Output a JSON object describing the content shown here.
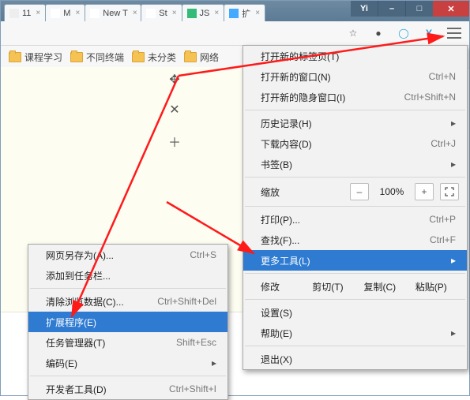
{
  "tabs": [
    "11",
    "M",
    "New T",
    "St",
    "JS",
    "扩"
  ],
  "win": {
    "yi": "Yi",
    "min": "–",
    "max": "□",
    "close": "✕"
  },
  "toolbar": {
    "star": "☆",
    "evernote": "●",
    "circle": "◯",
    "y": "Y"
  },
  "bookmarks": [
    "课程学习",
    "不同终端",
    "未分类",
    "网络"
  ],
  "tools": {
    "move": "✥",
    "close": "✕",
    "add": "＋"
  },
  "main": {
    "newtab": {
      "l": "打开新的标签页(T)",
      "s": ""
    },
    "newwin": {
      "l": "打开新的窗口(N)",
      "s": "Ctrl+N"
    },
    "incog": {
      "l": "打开新的隐身窗口(I)",
      "s": "Ctrl+Shift+N"
    },
    "history": {
      "l": "历史记录(H)",
      "s": ""
    },
    "downloads": {
      "l": "下载内容(D)",
      "s": "Ctrl+J"
    },
    "bookmarks": {
      "l": "书签(B)",
      "s": ""
    },
    "zoom": {
      "l": "缩放",
      "minus": "–",
      "val": "100%",
      "plus": "+"
    },
    "print": {
      "l": "打印(P)...",
      "s": "Ctrl+P"
    },
    "find": {
      "l": "查找(F)...",
      "s": "Ctrl+F"
    },
    "moretools": {
      "l": "更多工具(L)"
    },
    "edit": {
      "a": "修改",
      "cut": "剪切(T)",
      "copy": "复制(C)",
      "paste": "粘贴(P)"
    },
    "settings": {
      "l": "设置(S)"
    },
    "help": {
      "l": "帮助(E)"
    },
    "exit": {
      "l": "退出(X)"
    }
  },
  "sub": {
    "saveas": {
      "l": "网页另存为(A)...",
      "s": "Ctrl+S"
    },
    "addtobar": {
      "l": "添加到任务栏..."
    },
    "clear": {
      "l": "清除浏览数据(C)...",
      "s": "Ctrl+Shift+Del"
    },
    "ext": {
      "l": "扩展程序(E)"
    },
    "task": {
      "l": "任务管理器(T)",
      "s": "Shift+Esc"
    },
    "enc": {
      "l": "编码(E)"
    },
    "dev": {
      "l": "开发者工具(D)",
      "s": "Ctrl+Shift+I"
    }
  }
}
